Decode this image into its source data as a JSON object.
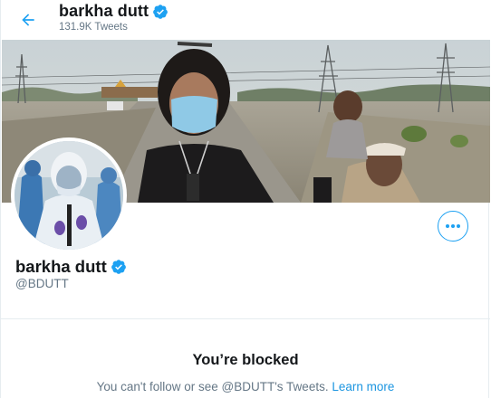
{
  "header": {
    "title": "barkha dutt",
    "tweet_count": "131.9K Tweets"
  },
  "profile": {
    "display_name": "barkha dutt",
    "handle": "@BDUTT"
  },
  "blocked": {
    "title": "You’re blocked",
    "message": "You can't follow or see @BDUTT's Tweets.",
    "link_label": "Learn more"
  },
  "colors": {
    "accent": "#1da1f2",
    "secondary_text": "#657786",
    "link": "#1b95e0"
  },
  "icons": {
    "back": "arrow-left-icon",
    "verified": "verified-badge-icon",
    "more": "more-horizontal-icon"
  }
}
